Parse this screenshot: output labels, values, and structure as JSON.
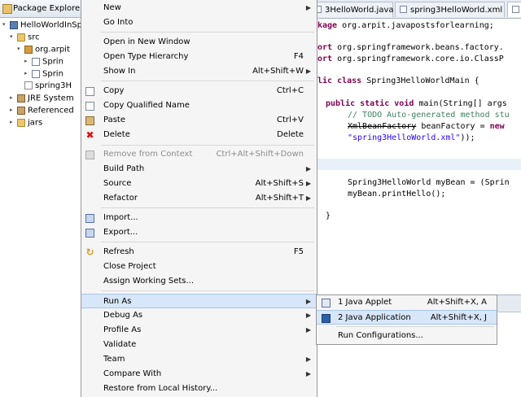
{
  "package_explorer": {
    "title": "Package Explorer",
    "items": [
      {
        "label": "HelloWorldInSp",
        "indent": 0,
        "twisty": "▾",
        "icon": "project-icon"
      },
      {
        "label": "src",
        "indent": 1,
        "twisty": "▾",
        "icon": "folder-icon"
      },
      {
        "label": "org.arpit",
        "indent": 2,
        "twisty": "▾",
        "icon": "package-icon"
      },
      {
        "label": "Sprin",
        "indent": 3,
        "twisty": "▸",
        "icon": "java-file-icon"
      },
      {
        "label": "Sprin",
        "indent": 3,
        "twisty": "▸",
        "icon": "java-file-icon"
      },
      {
        "label": "spring3H",
        "indent": 2,
        "twisty": "",
        "icon": "xml-file-icon"
      },
      {
        "label": "JRE System",
        "indent": 1,
        "twisty": "▸",
        "icon": "library-icon"
      },
      {
        "label": "Referenced",
        "indent": 1,
        "twisty": "▸",
        "icon": "library-icon"
      },
      {
        "label": "jars",
        "indent": 1,
        "twisty": "▸",
        "icon": "folder-icon"
      }
    ]
  },
  "editor": {
    "tabs": [
      {
        "label": "3HelloWorld.java"
      },
      {
        "label": "spring3HelloWorld.xml"
      }
    ],
    "code": {
      "l1_kw": "kage",
      "l1_rest": " org.arpit.javapostsforlearning;",
      "l2_kw": "ort",
      "l2_rest": " org.springframework.beans.factory.",
      "l3_kw": "ort",
      "l3_rest": " org.springframework.core.io.ClassP",
      "l4_kw": "lic class",
      "l4_rest": " Spring3HelloWorldMain {",
      "l5_kw": "public static void",
      "l5_rest": " main(String[] args",
      "l6_cm": "// TODO Auto-generated method stu",
      "l7_strike": "XmlBeanFactory",
      "l7_rest": " beanFactory = ",
      "l7_kw": "new",
      "l8_st": "\"spring3HelloWorld.xml\"",
      "l8_rest": "));",
      "l9_rest": "Spring3HelloWorld myBean = (Sprin",
      "l10_rest": "myBean.printHello();",
      "l11_rest": "}"
    }
  },
  "context_menu": {
    "new": {
      "label": "New"
    },
    "go_into": {
      "label": "Go Into"
    },
    "open_new_window": {
      "label": "Open in New Window"
    },
    "open_type_hierarchy": {
      "label": "Open Type Hierarchy",
      "shortcut": "F4"
    },
    "show_in": {
      "label": "Show In",
      "shortcut": "Alt+Shift+W"
    },
    "copy": {
      "label": "Copy",
      "shortcut": "Ctrl+C"
    },
    "copy_qualified": {
      "label": "Copy Qualified Name"
    },
    "paste": {
      "label": "Paste",
      "shortcut": "Ctrl+V"
    },
    "delete": {
      "label": "Delete",
      "shortcut": "Delete"
    },
    "remove_context": {
      "label": "Remove from Context",
      "shortcut": "Ctrl+Alt+Shift+Down"
    },
    "build_path": {
      "label": "Build Path"
    },
    "source": {
      "label": "Source",
      "shortcut": "Alt+Shift+S"
    },
    "refactor": {
      "label": "Refactor",
      "shortcut": "Alt+Shift+T"
    },
    "import": {
      "label": "Import..."
    },
    "export": {
      "label": "Export..."
    },
    "refresh": {
      "label": "Refresh",
      "shortcut": "F5"
    },
    "close_project": {
      "label": "Close Project"
    },
    "assign_working_sets": {
      "label": "Assign Working Sets..."
    },
    "run_as": {
      "label": "Run As"
    },
    "debug_as": {
      "label": "Debug As"
    },
    "profile_as": {
      "label": "Profile As"
    },
    "validate": {
      "label": "Validate"
    },
    "team": {
      "label": "Team"
    },
    "compare_with": {
      "label": "Compare With"
    },
    "restore_history": {
      "label": "Restore from Local History..."
    }
  },
  "run_as_submenu": {
    "java_applet": {
      "label": "1 Java Applet",
      "shortcut": "Alt+Shift+X, A"
    },
    "java_application": {
      "label": "2 Java Application",
      "shortcut": "Alt+Shift+X, J"
    },
    "run_configurations": {
      "label": "Run Configurations..."
    }
  },
  "colors": {
    "menu_bg": "#f5f5f5",
    "selection_bg": "#d7e6f8",
    "keyword": "#7f0055",
    "comment": "#3f7f5f",
    "string": "#2a00ff"
  }
}
